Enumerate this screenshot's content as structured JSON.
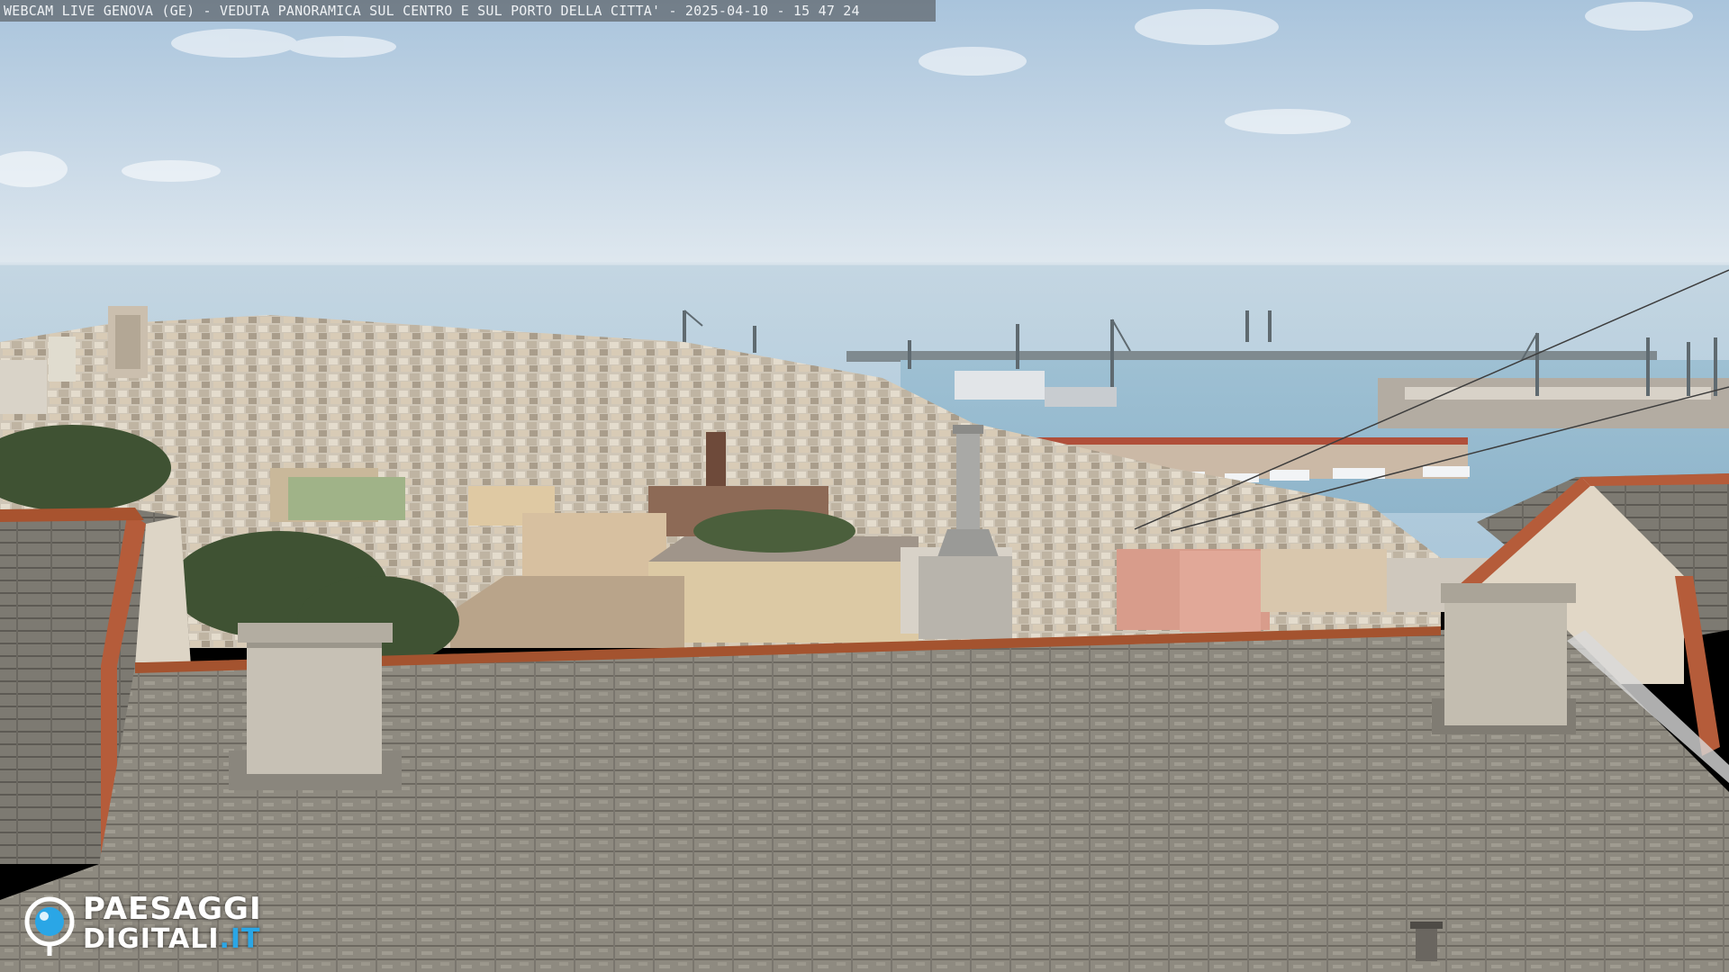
{
  "webcam": {
    "caption": "WEBCAM LIVE GENOVA (GE) - VEDUTA PANORAMICA SUL CENTRO E SUL PORTO DELLA CITTA' - 2025-04-10 - 15 47 24"
  },
  "watermark": {
    "brand_line1": "PAESAGGI",
    "brand_line2_main": "DIGITALI",
    "brand_line2_accent": ".IT",
    "icon": "camera-lens-icon"
  },
  "colors": {
    "sky_top": "#a9c4dc",
    "sky_horizon": "#dfe8ef",
    "sea": "#b7cfdf",
    "roof": "#8a857c",
    "terracotta": "#b05a3a",
    "brand_accent": "#2aa6e6"
  }
}
